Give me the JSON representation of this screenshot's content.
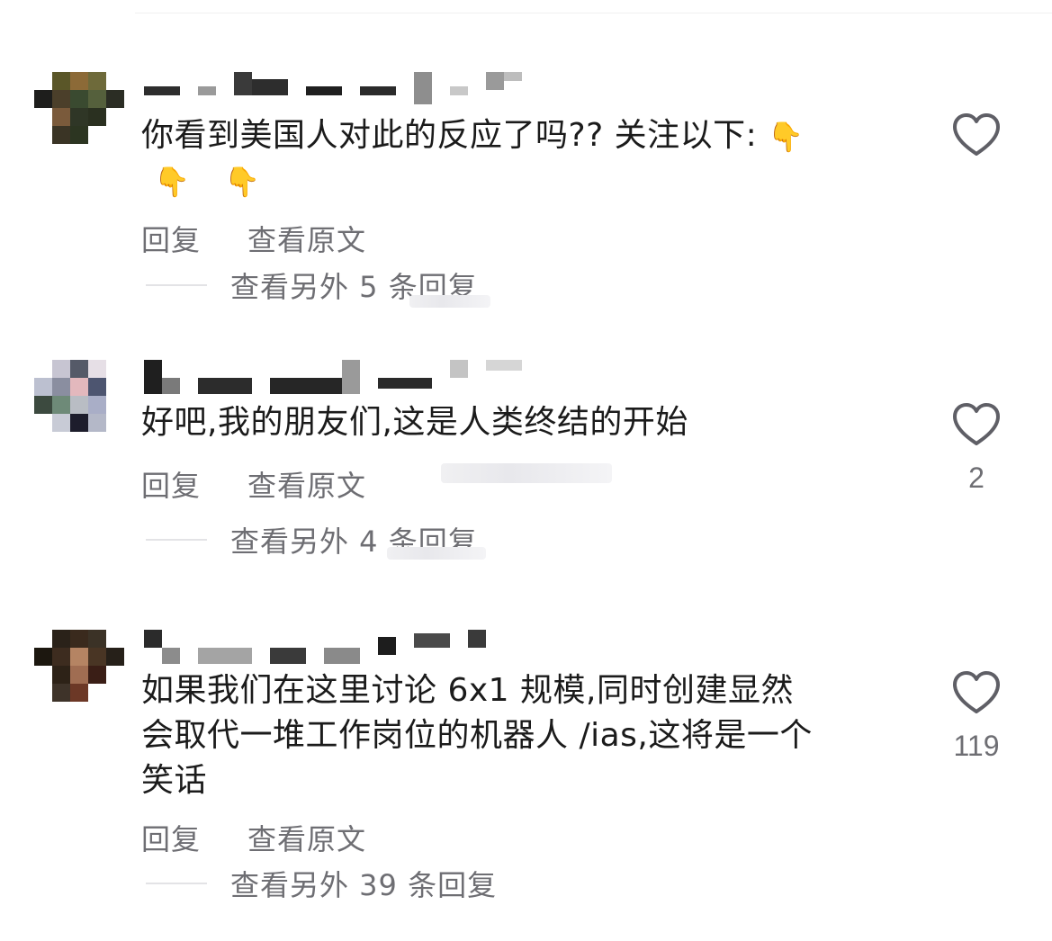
{
  "comments": [
    {
      "text": "你看到美国人对此的反应了吗?? 关注以下: ",
      "hands": [
        "👇",
        "👇",
        "👇"
      ],
      "reply_label": "回复",
      "view_original_label": "查看原文",
      "more_replies_label": "查看另外 5 条回复",
      "like_count": ""
    },
    {
      "text": "好吧,我的朋友们,这是人类终结的开始",
      "reply_label": "回复",
      "view_original_label": "查看原文",
      "more_replies_label": "查看另外 4 条回复",
      "like_count": "2"
    },
    {
      "text": "如果我们在这里讨论 6x1 规模,同时创建显然\n会取代一堆工作岗位的机器人 /ias,这将是一个\n笑话",
      "reply_label": "回复",
      "view_original_label": "查看原文",
      "more_replies_label": "查看另外 39 条回复",
      "like_count": "119"
    }
  ],
  "colors": {
    "text_primary": "#1b1b1b",
    "text_secondary": "#6e6e73",
    "heart_outline": "#5f5f66"
  },
  "icons": [
    "heart-outline-icon",
    "pointing-down-hand-emoji"
  ]
}
